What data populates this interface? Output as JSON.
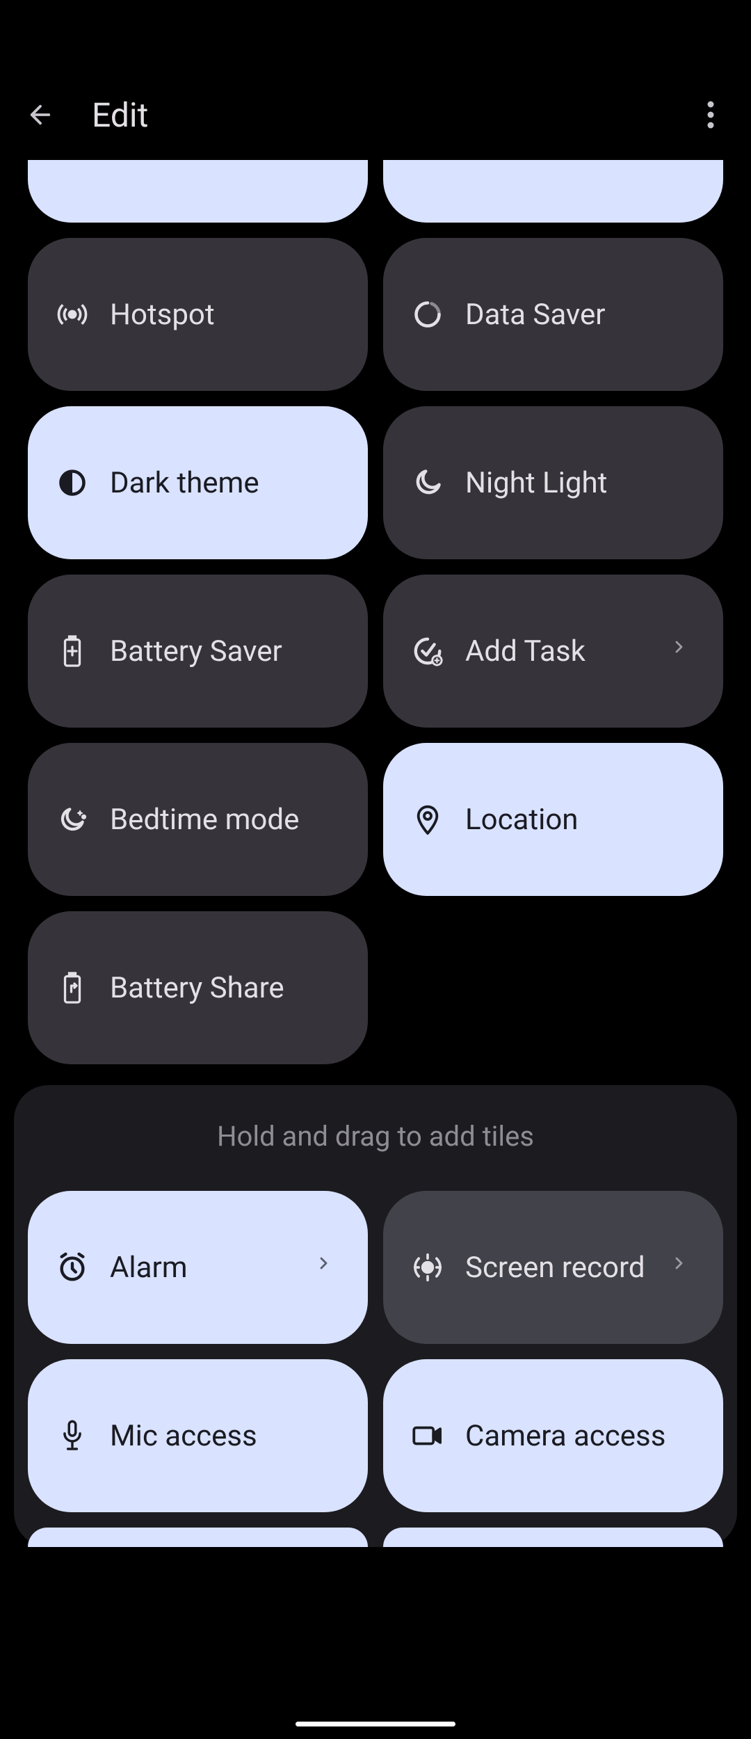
{
  "header": {
    "title": "Edit"
  },
  "tiles": {
    "hotspot": "Hotspot",
    "data_saver": "Data Saver",
    "dark_theme": "Dark theme",
    "night_light": "Night Light",
    "battery_saver": "Battery Saver",
    "add_task": "Add Task",
    "bedtime_mode": "Bedtime mode",
    "location": "Location",
    "battery_share": "Battery Share"
  },
  "section": {
    "hint": "Hold and drag to add tiles"
  },
  "available": {
    "alarm": "Alarm",
    "screen_record": "Screen record",
    "mic_access": "Mic access",
    "camera_access": "Camera access"
  }
}
